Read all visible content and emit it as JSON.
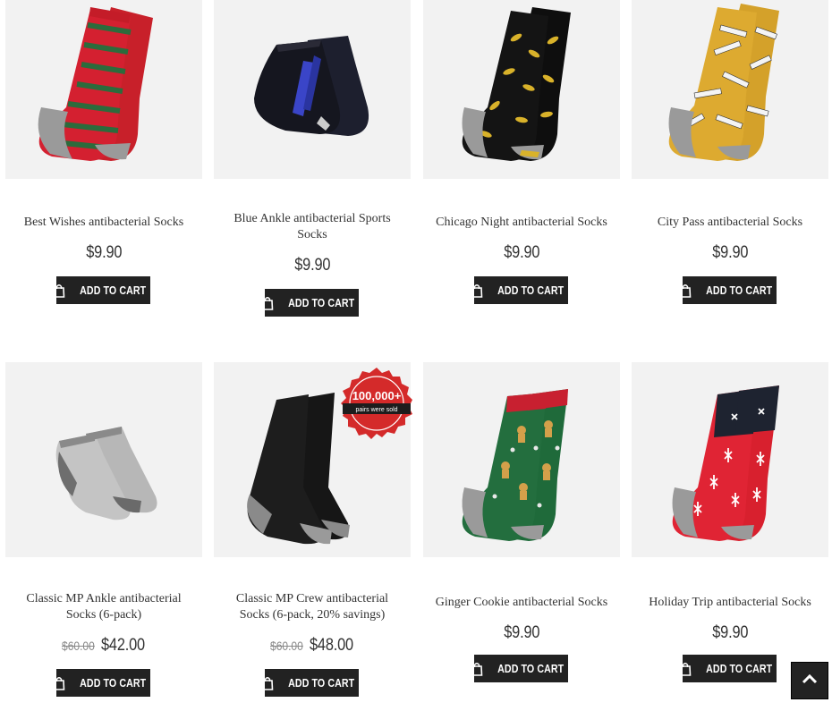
{
  "products": [
    {
      "title": "Best Wishes antibacterial Socks",
      "price": "$9.90",
      "old_price": "",
      "cart_label": "ADD TO CART",
      "image_icon": "red-green-striped-socks"
    },
    {
      "title": "Blue Ankle antibacterial Sports Socks",
      "price": "$9.90",
      "old_price": "",
      "cart_label": "ADD TO CART",
      "image_icon": "black-blue-ankle-socks"
    },
    {
      "title": "Chicago Night antibacterial Socks",
      "price": "$9.90",
      "old_price": "",
      "cart_label": "ADD TO CART",
      "image_icon": "black-yellow-socks"
    },
    {
      "title": "City Pass antibacterial Socks",
      "price": "$9.90",
      "old_price": "",
      "cart_label": "ADD TO CART",
      "image_icon": "mustard-ticket-socks"
    },
    {
      "title": "Classic MP Ankle antibacterial Socks (6-pack)",
      "price": "$42.00",
      "old_price": "$60.00",
      "cart_label": "ADD TO CART",
      "image_icon": "grey-ankle-socks"
    },
    {
      "title": "Classic MP Crew antibacterial Socks (6-pack, 20% savings)",
      "price": "$48.00",
      "old_price": "$60.00",
      "cart_label": "ADD TO CART",
      "image_icon": "black-crew-socks",
      "badge": {
        "big": "100,000+",
        "small": "pairs were sold"
      }
    },
    {
      "title": "Ginger Cookie antibacterial Socks",
      "price": "$9.90",
      "old_price": "",
      "cart_label": "ADD TO CART",
      "image_icon": "green-gingerbread-socks"
    },
    {
      "title": "Holiday Trip antibacterial Socks",
      "price": "$9.90",
      "old_price": "",
      "cart_label": "ADD TO CART",
      "image_icon": "red-navy-plane-socks"
    }
  ],
  "scroll_top_icon": "chevron-up-icon",
  "colors": {
    "button_bg": "#222222",
    "badge_red": "#d42a2a",
    "image_bg": "#f2f2f2"
  }
}
